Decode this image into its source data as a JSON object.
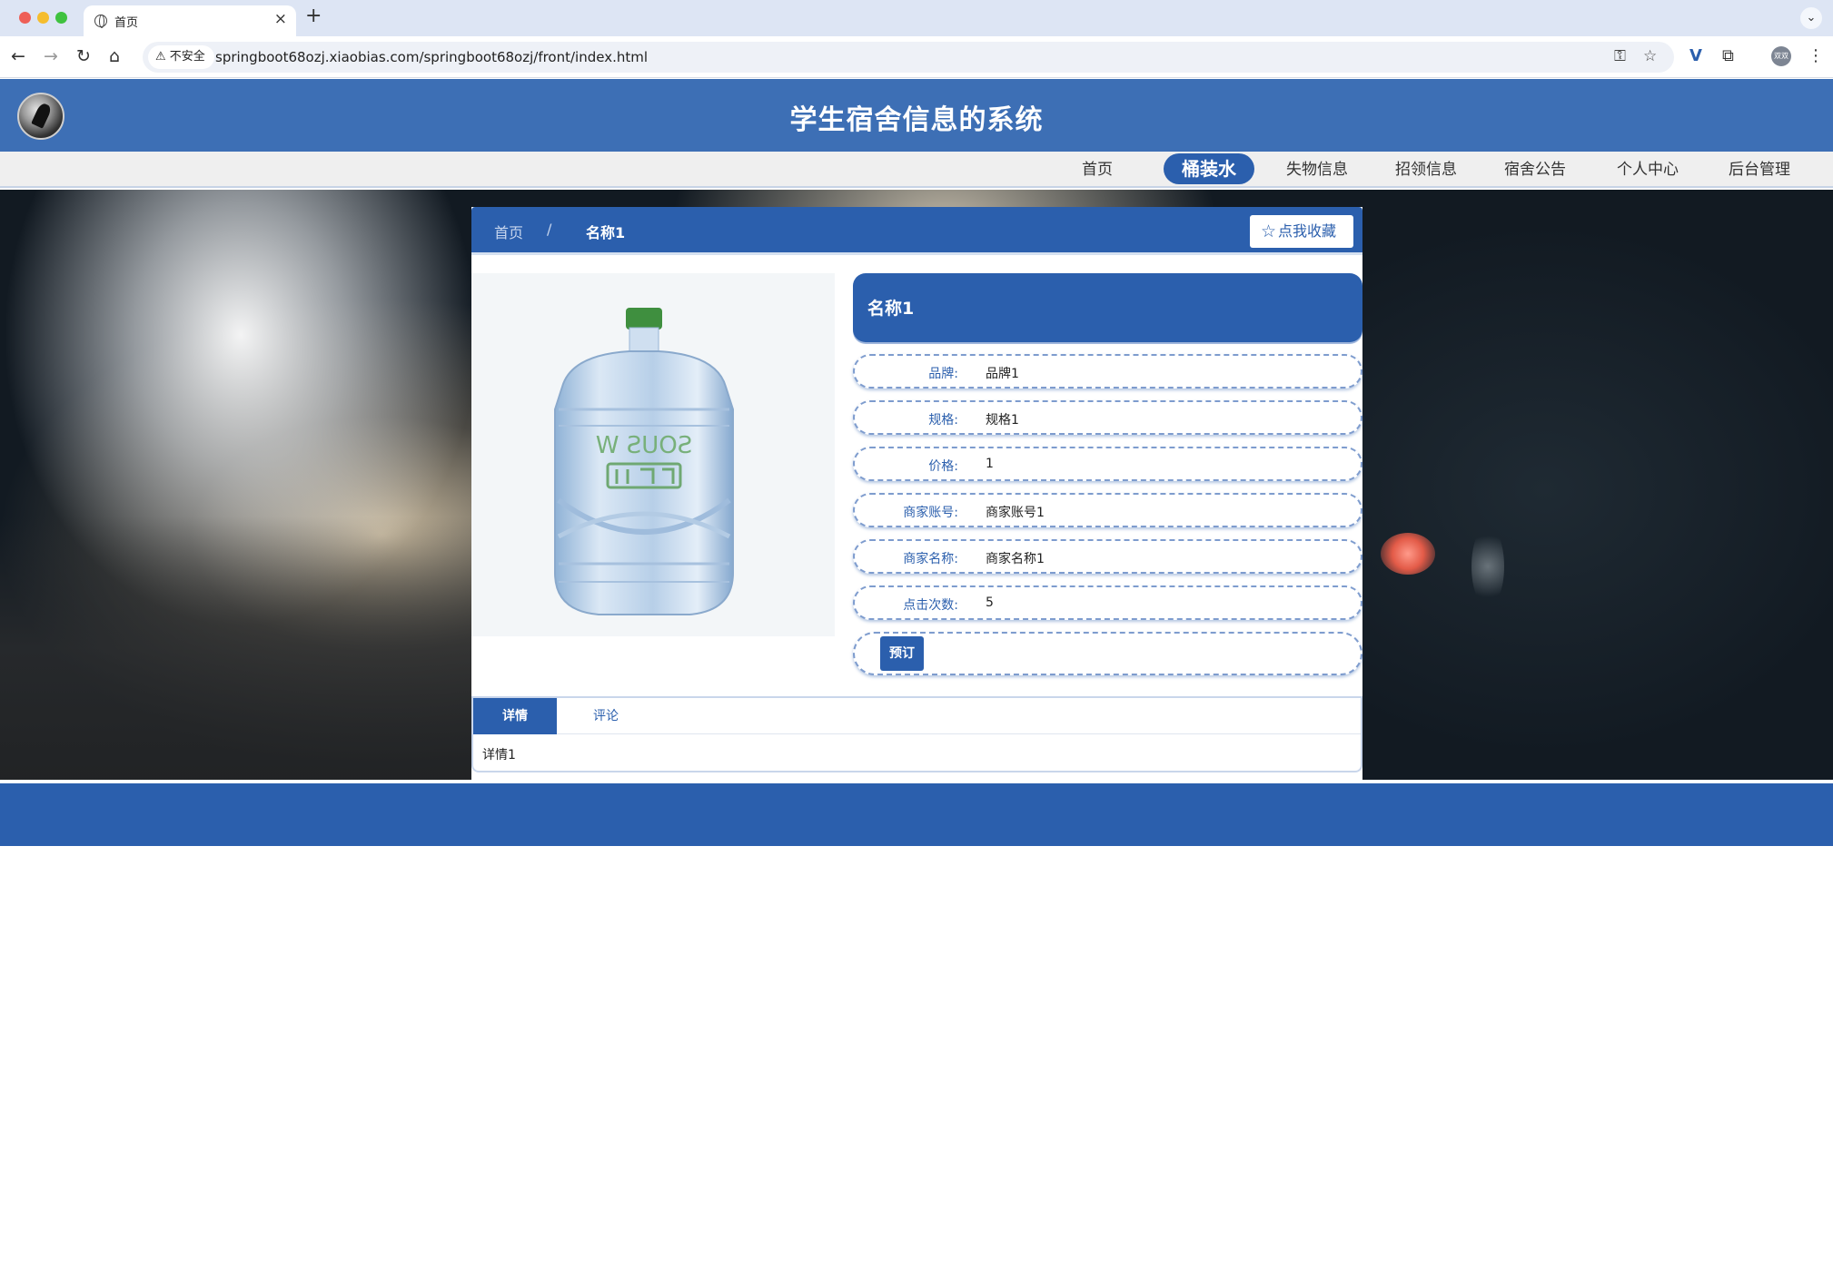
{
  "browser": {
    "tab_title": "首页",
    "new_tab_symbol": "+",
    "close_symbol": "×",
    "security_label": "不安全",
    "url": "springboot68ozj.xiaobias.com/springboot68ozj/front/index.html",
    "profile_initials": "双双"
  },
  "header": {
    "site_title": "学生宿舍信息的系统"
  },
  "nav": {
    "items": [
      {
        "label": "首页"
      },
      {
        "label": "桶装水"
      },
      {
        "label": "失物信息"
      },
      {
        "label": "招领信息"
      },
      {
        "label": "宿舍公告"
      },
      {
        "label": "个人中心"
      },
      {
        "label": "后台管理"
      }
    ],
    "active": "桶装水"
  },
  "breadcrumb": {
    "home": "首页",
    "separator": "/",
    "current": "名称1"
  },
  "favorite_button": {
    "label": "点我收藏"
  },
  "product": {
    "name": "名称1",
    "image_alt": "桶装水",
    "fields": [
      {
        "label": "品牌:",
        "value": "品牌1"
      },
      {
        "label": "规格:",
        "value": "规格1"
      },
      {
        "label": "价格:",
        "value": "1"
      },
      {
        "label": "商家账号:",
        "value": "商家账号1"
      },
      {
        "label": "商家名称:",
        "value": "商家名称1"
      },
      {
        "label": "点击次数:",
        "value": "5"
      }
    ],
    "order_button": "预订"
  },
  "tabs": {
    "items": [
      {
        "label": "详情"
      },
      {
        "label": "评论"
      }
    ],
    "active": "详情",
    "content": "详情1"
  },
  "colors": {
    "primary": "#2b5fad",
    "header": "#3d6fb5",
    "navbar": "#efefef"
  }
}
